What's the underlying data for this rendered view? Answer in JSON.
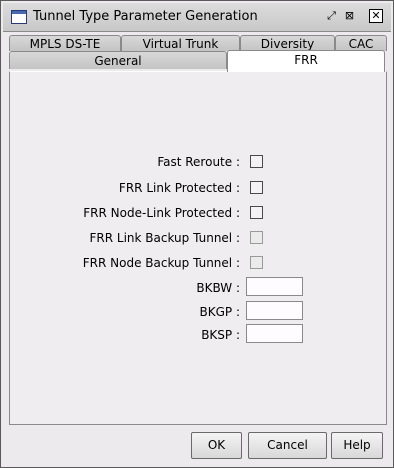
{
  "window": {
    "title": "Tunnel Type Parameter Generation",
    "controls": {
      "restore_glyph": "⤢",
      "maximize_glyph": "⊠",
      "close_glyph": "✕"
    }
  },
  "tabs": {
    "row1": [
      "MPLS DS-TE",
      "Virtual Trunk",
      "Diversity",
      "CAC"
    ],
    "row2": [
      "General",
      "FRR"
    ],
    "active": "FRR"
  },
  "frr": {
    "fast_reroute_label": "Fast Reroute :",
    "link_protected_label": "FRR Link Protected :",
    "node_link_protected_label": "FRR Node-Link Protected :",
    "link_backup_tunnel_label": "FRR Link Backup Tunnel :",
    "node_backup_tunnel_label": "FRR Node Backup Tunnel :",
    "fast_reroute_checked": false,
    "link_protected_checked": false,
    "node_link_protected_checked": false,
    "link_backup_tunnel_checked": false,
    "node_backup_tunnel_checked": false,
    "bkbw_label": "BKBW :",
    "bkgp_label": "BKGP :",
    "bksp_label": "BKSP :",
    "bkbw_value": "",
    "bkgp_value": "",
    "bksp_value": ""
  },
  "buttons": {
    "ok": "OK",
    "cancel": "Cancel",
    "help": "Help"
  }
}
